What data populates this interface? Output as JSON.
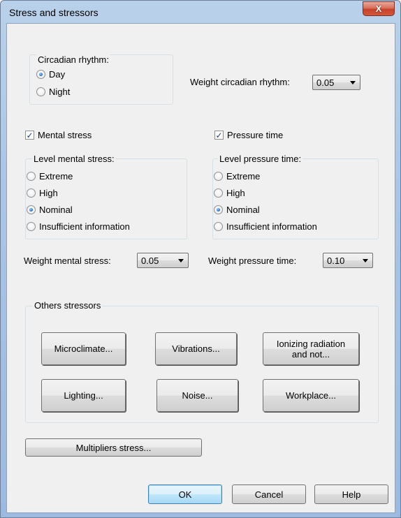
{
  "window": {
    "title": "Stress and stressors",
    "close_label": "X"
  },
  "circadian": {
    "group_label": "Circadian rhythm:",
    "options": [
      {
        "label": "Day",
        "selected": true
      },
      {
        "label": "Night",
        "selected": false
      }
    ],
    "weight_label": "Weight circadian rhythm:",
    "weight_value": "0.05"
  },
  "mental": {
    "checkbox_label": "Mental stress",
    "checked": true,
    "group_label": "Level mental stress:",
    "options": [
      {
        "label": "Extreme",
        "selected": false
      },
      {
        "label": "High",
        "selected": false
      },
      {
        "label": "Nominal",
        "selected": true
      },
      {
        "label": "Insufficient information",
        "selected": false
      }
    ],
    "weight_label": "Weight mental stress:",
    "weight_value": "0.05"
  },
  "pressure": {
    "checkbox_label": "Pressure time",
    "checked": true,
    "group_label": "Level pressure time:",
    "options": [
      {
        "label": "Extreme",
        "selected": false
      },
      {
        "label": "High",
        "selected": false
      },
      {
        "label": "Nominal",
        "selected": true
      },
      {
        "label": "Insufficient information",
        "selected": false
      }
    ],
    "weight_label": "Weight pressure time:",
    "weight_value": "0.10"
  },
  "others": {
    "group_label": "Others stressors",
    "buttons": {
      "microclimate": "Microclimate...",
      "vibrations": "Vibrations...",
      "ionizing_line1": "Ionizing radiation",
      "ionizing_line2": "and not...",
      "lighting": "Lighting...",
      "noise": "Noise...",
      "workplace": "Workplace..."
    }
  },
  "multipliers_label": "Multipliers stress...",
  "footer": {
    "ok": "OK",
    "cancel": "Cancel",
    "help": "Help"
  },
  "colors": {
    "titlebar": "#a9c4e4",
    "client": "#f0f0f0",
    "close": "#c7422a",
    "default_button": "#a7d9f5"
  },
  "icons": {
    "close": "close-icon",
    "dropdown": "chevron-down-icon"
  }
}
